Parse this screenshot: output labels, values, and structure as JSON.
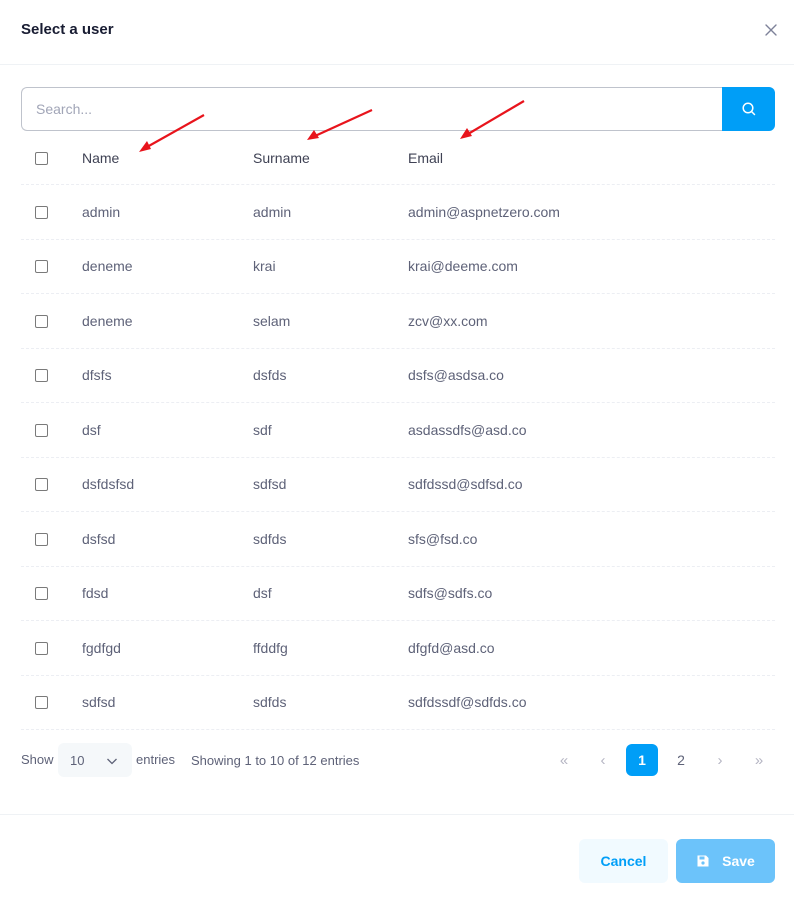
{
  "modal": {
    "title": "Select a user",
    "close_icon": "close-icon"
  },
  "search": {
    "placeholder": "Search...",
    "value": "",
    "button_icon": "search-icon"
  },
  "table": {
    "columns": [
      "Name",
      "Surname",
      "Email"
    ],
    "rows": [
      {
        "name": "admin",
        "surname": "admin",
        "email": "admin@aspnetzero.com"
      },
      {
        "name": "deneme",
        "surname": "krai",
        "email": "krai@deeme.com"
      },
      {
        "name": "deneme",
        "surname": "selam",
        "email": "zcv@xx.com"
      },
      {
        "name": "dfsfs",
        "surname": "dsfds",
        "email": "dsfs@asdsa.co"
      },
      {
        "name": "dsf",
        "surname": "sdf",
        "email": "asdassdfs@asd.co"
      },
      {
        "name": "dsfdsfsd",
        "surname": "sdfsd",
        "email": "sdfdssd@sdfsd.co"
      },
      {
        "name": "dsfsd",
        "surname": "sdfds",
        "email": "sfs@fsd.co"
      },
      {
        "name": "fdsd",
        "surname": "dsf",
        "email": "sdfs@sdfs.co"
      },
      {
        "name": "fgdfgd",
        "surname": "ffddfg",
        "email": "dfgfd@asd.co"
      },
      {
        "name": "sdfsd",
        "surname": "sdfds",
        "email": "sdfdssdf@sdfds.co"
      }
    ]
  },
  "pagination": {
    "show_label": "Show",
    "page_length": "10",
    "entries_label": "entries",
    "info": "Showing 1 to 10 of 12 entries",
    "first": "«",
    "prev": "‹",
    "pages": [
      "1",
      "2"
    ],
    "current_page": "1",
    "next": "›",
    "last": "»"
  },
  "footer": {
    "cancel_label": "Cancel",
    "save_label": "Save",
    "save_icon": "save-icon"
  },
  "colors": {
    "primary": "#009ef7",
    "annotation_arrow": "#e8141c"
  }
}
